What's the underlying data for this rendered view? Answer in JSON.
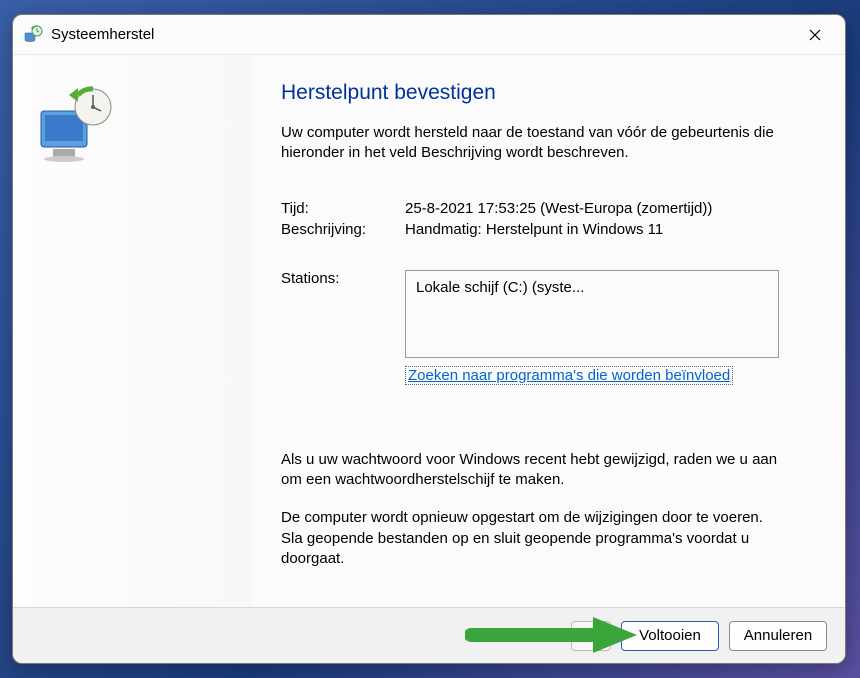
{
  "window": {
    "title": "Systeemherstel"
  },
  "page": {
    "heading": "Herstelpunt bevestigen",
    "intro": "Uw computer wordt hersteld naar de toestand van vóór de gebeurtenis die hieronder in het veld Beschrijving wordt beschreven.",
    "labels": {
      "time": "Tijd:",
      "description": "Beschrijving:",
      "stations": "Stations:"
    },
    "values": {
      "time": "25-8-2021 17:53:25 (West-Europa (zomertijd))",
      "description": "Handmatig: Herstelpunt in Windows 11",
      "station_item": "Lokale schijf (C:) (syste..."
    },
    "scan_link": "Zoeken naar programma's die worden beïnvloed",
    "note1": "Als u uw wachtwoord voor Windows recent hebt gewijzigd, raden we u aan om een wachtwoordherstelschijf te maken.",
    "note2": "De computer wordt opnieuw opgestart om de wijzigingen door te voeren. Sla geopende bestanden op en sluit geopende programma's voordat u doorgaat."
  },
  "buttons": {
    "back": "",
    "finish": "Voltooien",
    "cancel": "Annuleren"
  }
}
